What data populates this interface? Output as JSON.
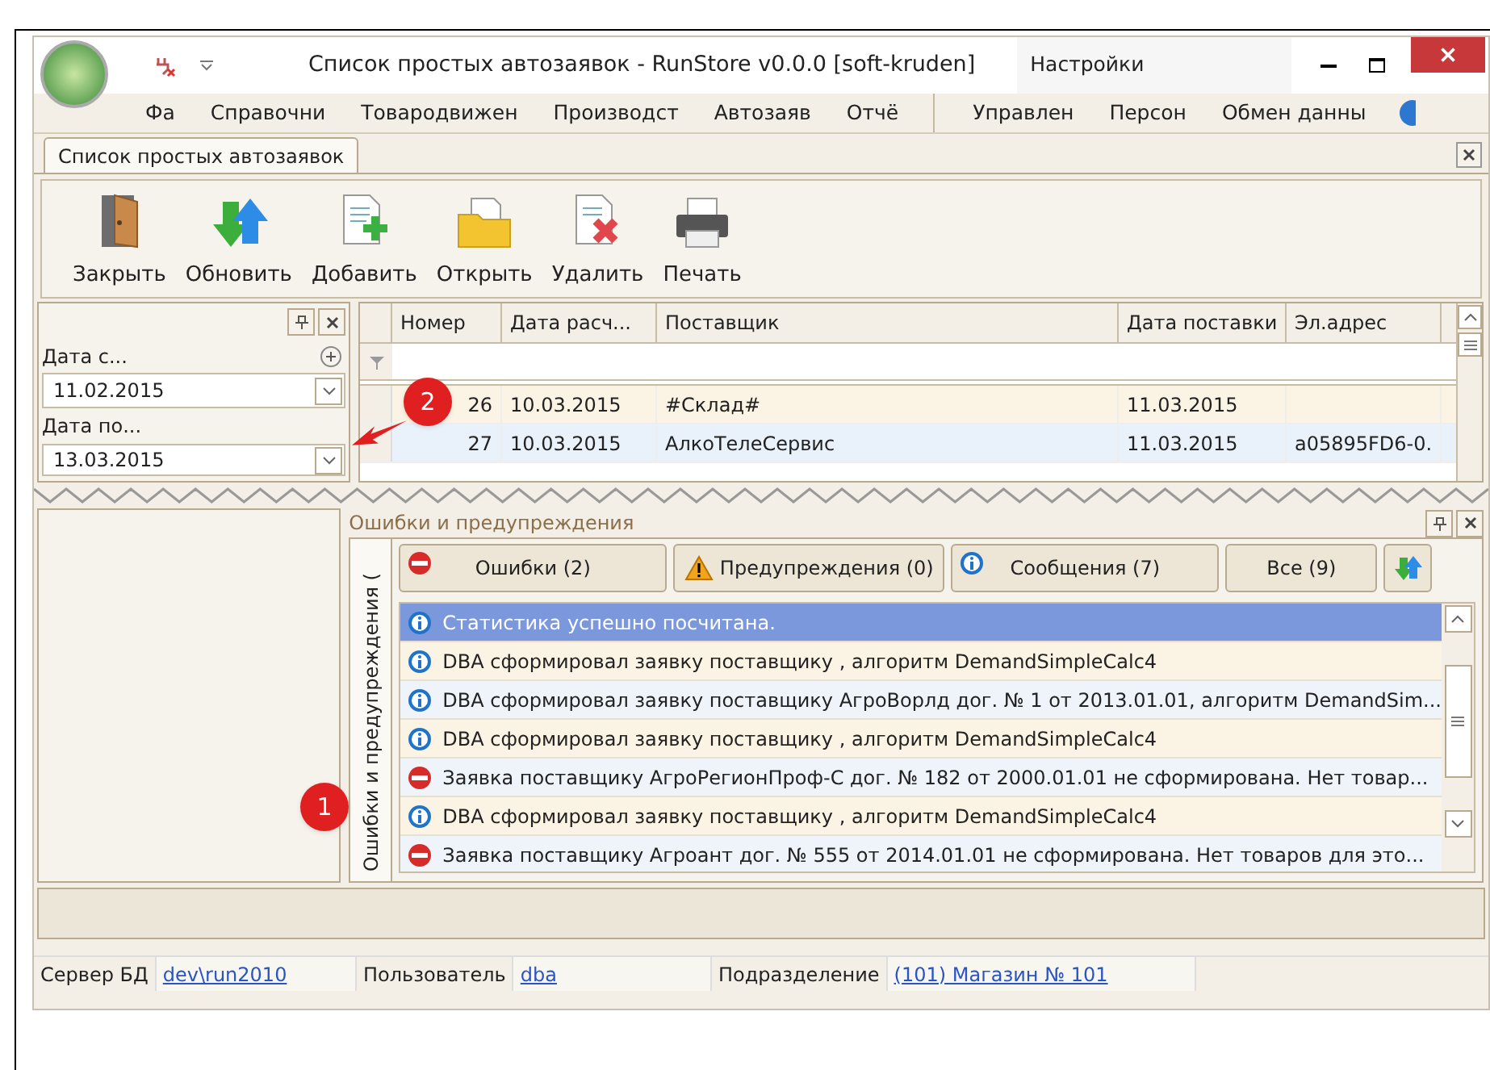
{
  "window": {
    "title": "Список простых автозаявок - RunStore v0.0.0 [soft-kruden]",
    "context_group": "Настройки"
  },
  "menu": [
    "Фа",
    "Справочни",
    "Товародвижен",
    "Производст",
    "Автозаяв",
    "Отчё",
    "Управлен",
    "Персон",
    "Обмен данны"
  ],
  "document_tab": {
    "label": "Список простых автозаявок",
    "selected": true
  },
  "toolbar": [
    {
      "kind": "close",
      "label": "Закрыть"
    },
    {
      "kind": "refresh",
      "label": "Обновить"
    },
    {
      "kind": "add",
      "label": "Добавить"
    },
    {
      "kind": "open",
      "label": "Открыть"
    },
    {
      "kind": "delete",
      "label": "Удалить"
    },
    {
      "kind": "print",
      "label": "Печать"
    }
  ],
  "filter_panel": {
    "date_from": {
      "label": "Дата с...",
      "value": "11.02.2015"
    },
    "date_to": {
      "label": "Дата по...",
      "value": "13.03.2015"
    }
  },
  "table": {
    "columns": [
      "Номер",
      "Дата расч...",
      "Поставщик",
      "Дата поставки",
      "Эл.адрес"
    ],
    "rows": [
      {
        "cells": [
          "26",
          "10.03.2015",
          "#Склад#",
          "11.03.2015",
          ""
        ],
        "selected": false
      },
      {
        "cells": [
          "27",
          "10.03.2015",
          "АлкоТелеСервис",
          "11.03.2015",
          "a05895FD6-0."
        ],
        "selected": true
      }
    ]
  },
  "messages_panel": {
    "title": "Ошибки и предупреждения",
    "side_tab": "Ошибки и предупреждения (",
    "filters": [
      {
        "kind": "error",
        "label": "Ошибки (2)"
      },
      {
        "kind": "warning",
        "label": "Предупреждения (0)"
      },
      {
        "kind": "info",
        "label": "Сообщения (7)"
      },
      {
        "kind": "all",
        "label": "Все (9)"
      }
    ],
    "messages": [
      {
        "kind": "info",
        "text": "Статистика успешно посчитана.",
        "selected": true
      },
      {
        "kind": "info",
        "text": "DBA сформировал заявку поставщику , алгоритм DemandSimpleCalc4",
        "selected": false
      },
      {
        "kind": "info",
        "text": "DBA сформировал заявку поставщику АгроВорлд дог. № 1 от 2013.01.01, алгоритм DemandSim...",
        "selected": false
      },
      {
        "kind": "info",
        "text": "DBA сформировал заявку поставщику , алгоритм DemandSimpleCalc4",
        "selected": false
      },
      {
        "kind": "error",
        "text": "Заявка поставщику АгроРегионПроф-С дог. № 182 от 2000.01.01 не сформирована. Нет товар...",
        "selected": false
      },
      {
        "kind": "info",
        "text": "DBA сформировал заявку поставщику , алгоритм DemandSimpleCalc4",
        "selected": false
      },
      {
        "kind": "error",
        "text": "Заявка поставщику Агроант дог. № 555 от 2014.01.01 не сформирована. Нет товаров для это...",
        "selected": false
      }
    ]
  },
  "status_bar": [
    {
      "label": "Сервер БД",
      "value": "dev\\run2010"
    },
    {
      "label": "Пользователь",
      "value": "dba"
    },
    {
      "label": "Подразделение",
      "value": "(101) Магазин № 101"
    }
  ],
  "callouts": [
    "1",
    "2"
  ]
}
